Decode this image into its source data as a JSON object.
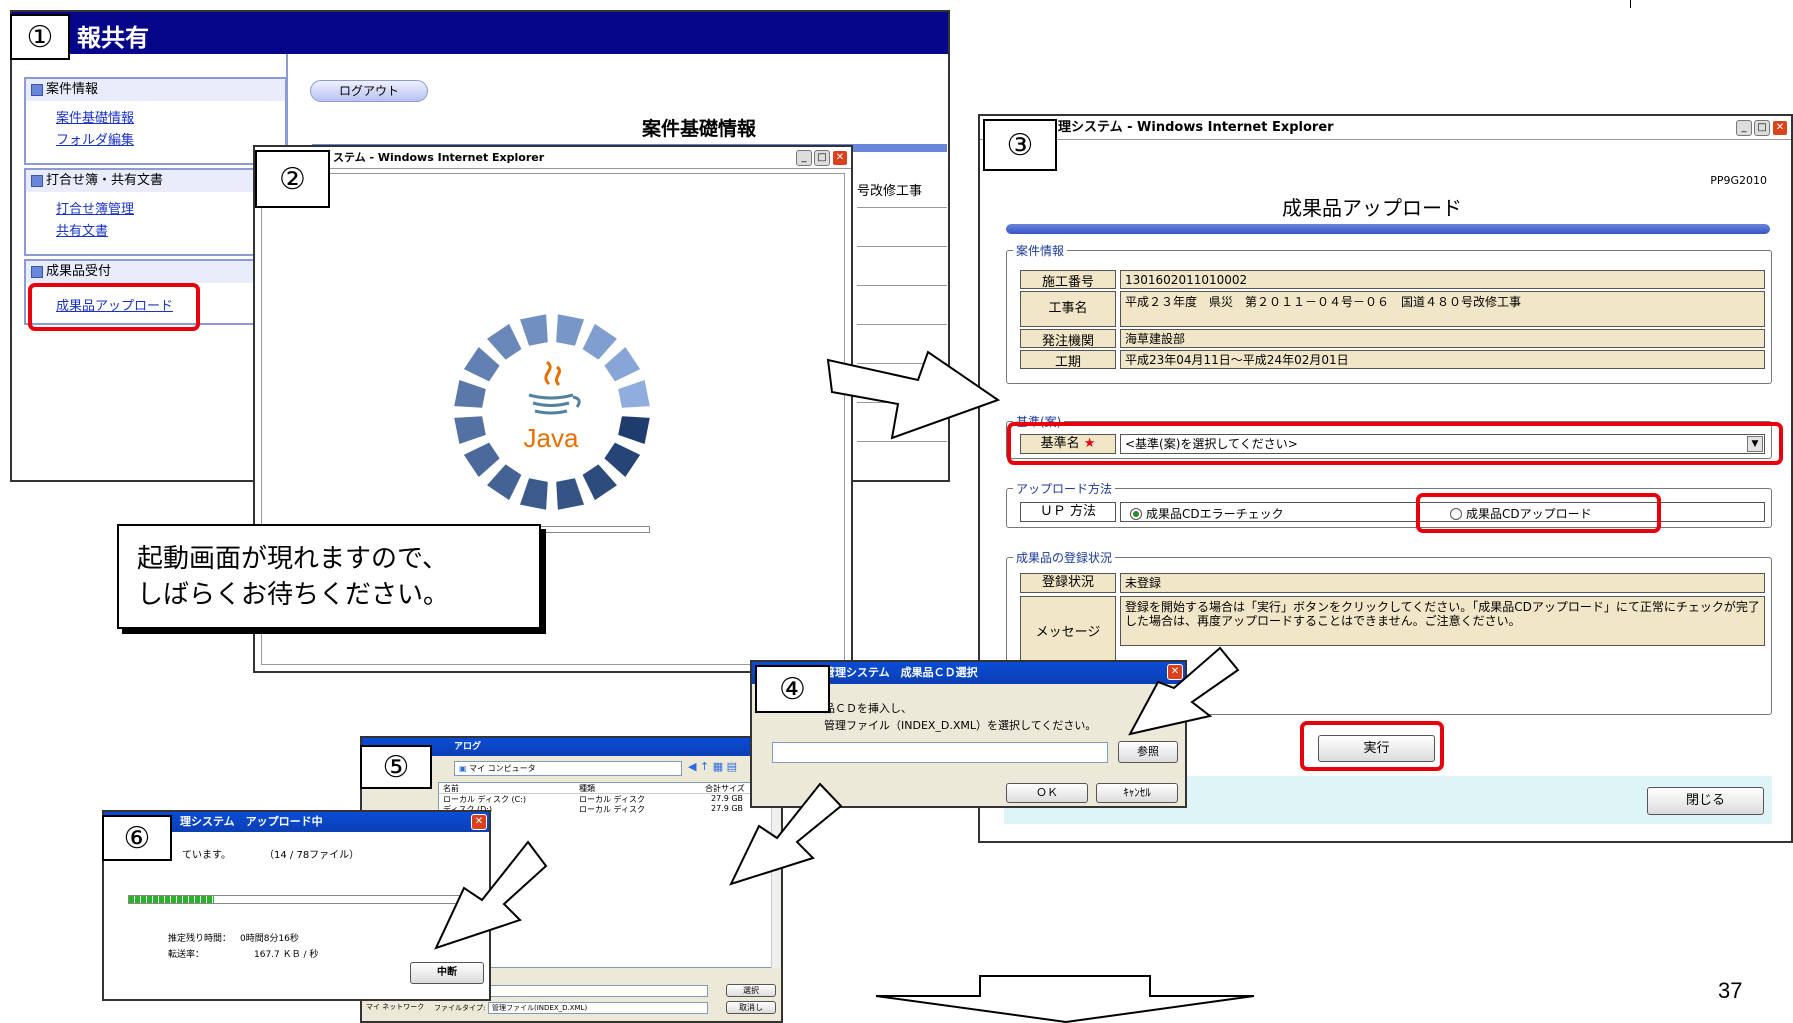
{
  "page_number": "37",
  "step_numbers": [
    "①",
    "②",
    "③",
    "④",
    "⑤",
    "⑥"
  ],
  "panel1": {
    "title": "報共有",
    "logout": "ログアウト",
    "heading": "案件基礎情報",
    "partial_text": "号改修工事",
    "sections": [
      {
        "header": "案件情報",
        "links": [
          "案件基礎情報",
          "フォルダ編集"
        ]
      },
      {
        "header": "打合せ簿・共有文書",
        "links": [
          "打合せ簿管理",
          "共有文書"
        ]
      },
      {
        "header": "成果品受付",
        "links": [
          "成果品アップロード"
        ]
      }
    ]
  },
  "panel2": {
    "title": "ステム - Windows Internet Explorer",
    "java_label": "Java"
  },
  "callout": {
    "line1": "起動画面が現れますので、",
    "line2": "しばらくお待ちください。"
  },
  "panel3": {
    "title": "理システム - Windows Internet Explorer",
    "code": "PP9G2010",
    "heading": "成果品アップロード",
    "case_legend": "案件情報",
    "case_rows": [
      {
        "label": "施工番号",
        "value": "1301602011010002"
      },
      {
        "label": "工事名",
        "value": "平成２３年度　県災　第２０１１－０４号－０６　国道４８０号改修工事"
      },
      {
        "label": "発注機関",
        "value": "海草建設部"
      },
      {
        "label": "工期",
        "value": "平成23年04月11日～平成24年02月01日"
      }
    ],
    "standard_legend": "基準(案)",
    "standard_label": "基準名",
    "standard_star": "★",
    "standard_value": "<基準(案)を選択してください>",
    "upload_legend": "アップロード方法",
    "upload_label": "ＵＰ 方法",
    "option1": "成果品CDエラーチェック",
    "option2": "成果品CDアップロード",
    "status_legend": "成果品の登録状況",
    "status_label": "登録状況",
    "status_value": "未登録",
    "message_label": "メッセージ",
    "message_value": "登録を開始する場合は「実行」ボタンをクリックしてください。「成果品CDアップロード」にて正常にチェックが完了した場合は、再度アップロードすることはできません。ご注意ください。",
    "run_button": "実行",
    "close_button": "閉じる"
  },
  "panel4": {
    "title": "管理システム　成果品ＣＤ選択",
    "line1": "品ＣＤを挿入し、",
    "line2": "管理ファイル（INDEX_D.XML）を選択してください。",
    "browse": "参照",
    "ok": "ＯＫ",
    "cancel": "ｷｬﾝｾﾙ"
  },
  "panel5": {
    "title": "アログ",
    "location": "マイ コンピュータ",
    "columns": [
      "名前",
      "種類",
      "合計サイズ"
    ],
    "rows": [
      {
        "name": "ローカル ディスク (C:)",
        "type": "ローカル ディスク",
        "size": "27.9 GB"
      },
      {
        "name": "ディスク (D:)",
        "type": "ローカル ディスク",
        "size": "27.9 GB"
      }
    ],
    "select_btn": "選択",
    "cancel_btn": "取消し",
    "filetype_label": "ファイルタイプ:",
    "filetype_value": "管理ファイル(INDEX_D.XML)",
    "network": "マイ ネットワーク"
  },
  "panel6": {
    "title": "理システム　アップロード中",
    "status": "ています。",
    "count": "（14 / 78ファイル）",
    "progress": 0.25,
    "remaining_label": "推定残り時間：",
    "remaining_value": "0時間8分16秒",
    "rate_label": "転送率：",
    "rate_value": "167.7 ＫＢ / 秒",
    "abort": "中断"
  }
}
